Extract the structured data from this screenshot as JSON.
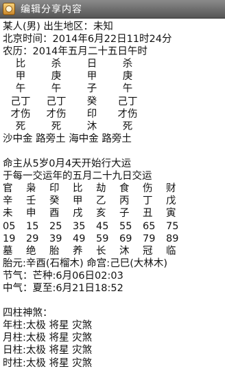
{
  "window": {
    "title": "编辑分享内容"
  },
  "header_lines": [
    "某人(男) 出生地区：未知",
    "北京时间：2014年6月22日11时24分",
    "农历：2014年五月二十五日午时"
  ],
  "pillars": [
    [
      "比",
      "杀",
      "日",
      "杀"
    ],
    [
      "甲",
      "庚",
      "甲",
      "庚"
    ],
    [
      "午",
      "午",
      "子",
      "午"
    ],
    [
      "己丁",
      "己丁",
      "癸",
      "己丁"
    ],
    [
      "才伤",
      "才伤",
      "印",
      "才伤"
    ],
    [
      "死",
      "死",
      "沐",
      "死"
    ]
  ],
  "nayin_line": "沙中金 路旁土 海中金 路旁土",
  "luck_intro": [
    "命主从5岁0月4天开始行大运",
    "于每一交运年的五月二十九日交运"
  ],
  "dayun": [
    [
      "官",
      "枭",
      "印",
      "比",
      "劫",
      "食",
      "伤",
      "财"
    ],
    [
      "辛",
      "壬",
      "癸",
      "甲",
      "乙",
      "丙",
      "丁",
      "戊"
    ],
    [
      "未",
      "申",
      "酉",
      "戌",
      "亥",
      "子",
      "丑",
      "寅"
    ],
    [
      "05",
      "15",
      "25",
      "35",
      "45",
      "55",
      "65",
      "75"
    ],
    [
      "19",
      "29",
      "39",
      "49",
      "59",
      "69",
      "79",
      "89"
    ],
    [
      "墓",
      "绝",
      "胎",
      "养",
      "长",
      "沐",
      "冠",
      "临"
    ]
  ],
  "extra_lines": [
    "胎元:辛酉(石榴木) 命宫:己巳(大林木)",
    "节气：芒种:6月06日02:03",
    "中气：夏至:6月21日18:52"
  ],
  "shensha_title": "四柱神煞：",
  "shensha_lines": [
    "年柱:太极 将星 灾煞",
    "月柱:太极 将星 灾煞",
    "日柱:太极 将星 灾煞",
    "时柱:太极 将星 灾煞"
  ]
}
